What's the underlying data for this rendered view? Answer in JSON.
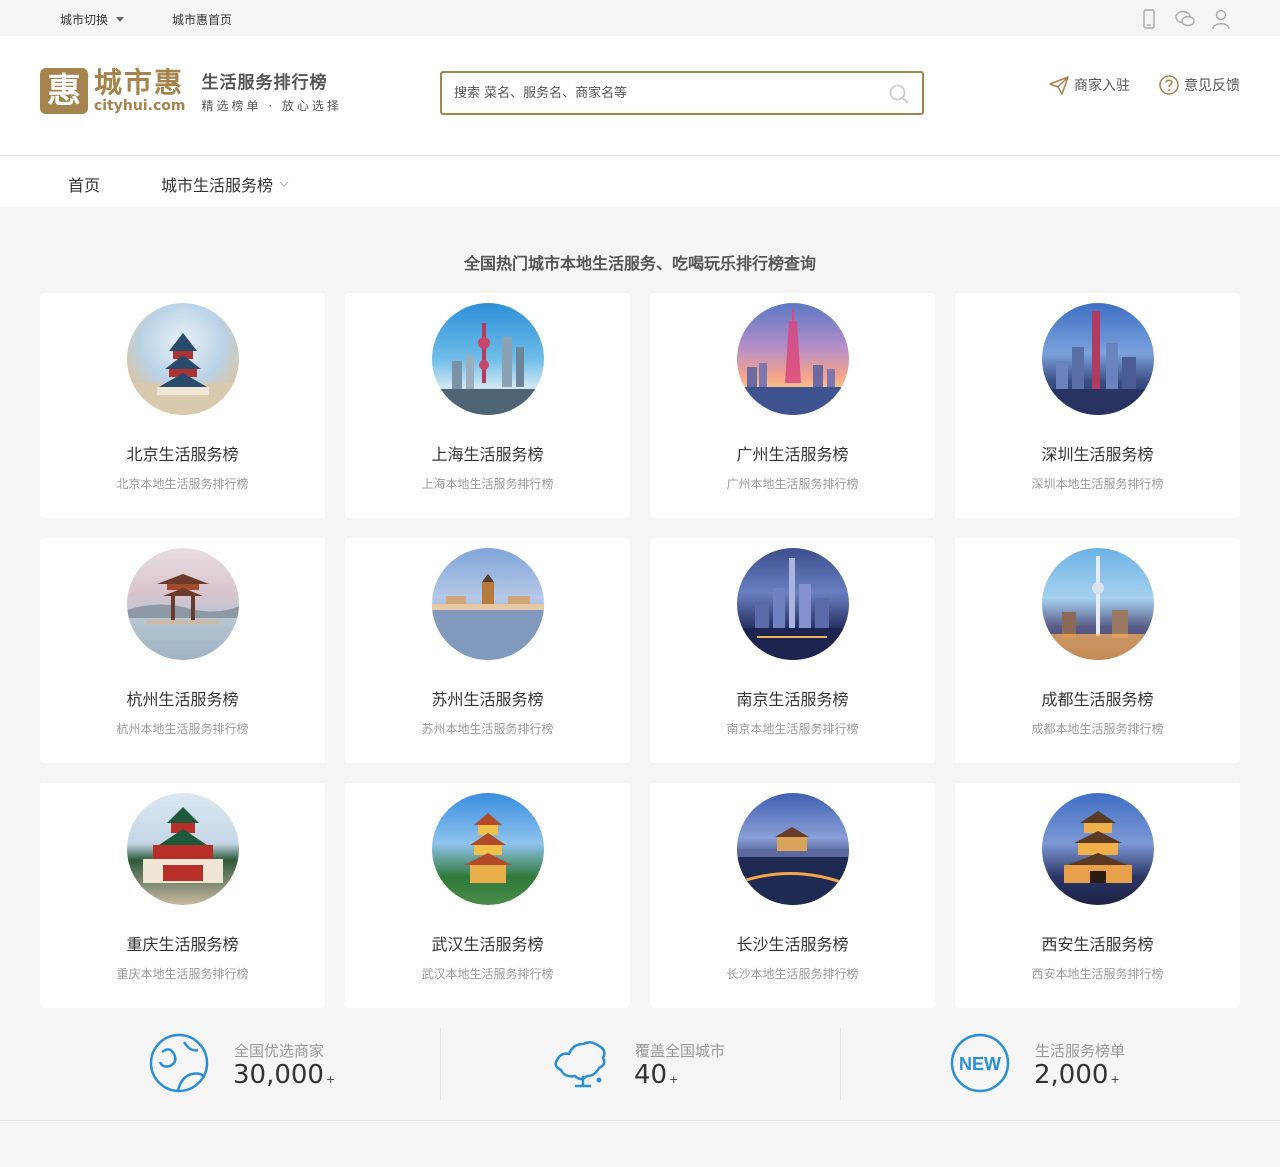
{
  "topbar": {
    "city_switch": "城市切换",
    "home_link": "城市惠首页",
    "icons": [
      "phone-icon",
      "wechat-icon",
      "user-icon"
    ]
  },
  "header": {
    "logo_mark": "惠",
    "logo_cn": "城市惠",
    "logo_en": "cityhui.com",
    "slogan_main": "生活服务排行榜",
    "slogan_sub": "精选榜单 · 放心选择",
    "search_placeholder": "搜索 菜名、服务名、商家名等",
    "actions": [
      {
        "label": "商家入驻",
        "icon": "paper-plane-icon"
      },
      {
        "label": "意见反馈",
        "icon": "question-icon"
      }
    ],
    "accent": "#a5834d"
  },
  "nav": {
    "items": [
      "首页",
      "城市生活服务榜"
    ]
  },
  "main": {
    "title": "全国热门城市本地生活服务、吃喝玩乐排行榜查询",
    "cities": [
      {
        "name": "北京生活服务榜",
        "sub": "北京本地生活服务排行榜"
      },
      {
        "name": "上海生活服务榜",
        "sub": "上海本地生活服务排行榜"
      },
      {
        "name": "广州生活服务榜",
        "sub": "广州本地生活服务排行榜"
      },
      {
        "name": "深圳生活服务榜",
        "sub": "深圳本地生活服务排行榜"
      },
      {
        "name": "杭州生活服务榜",
        "sub": "杭州本地生活服务排行榜"
      },
      {
        "name": "苏州生活服务榜",
        "sub": "苏州本地生活服务排行榜"
      },
      {
        "name": "南京生活服务榜",
        "sub": "南京本地生活服务排行榜"
      },
      {
        "name": "成都生活服务榜",
        "sub": "成都本地生活服务排行榜"
      },
      {
        "name": "重庆生活服务榜",
        "sub": "重庆本地生活服务排行榜"
      },
      {
        "name": "武汉生活服务榜",
        "sub": "武汉本地生活服务排行榜"
      },
      {
        "name": "长沙生活服务榜",
        "sub": "长沙本地生活服务排行榜"
      },
      {
        "name": "西安生活服务榜",
        "sub": "西安本地生活服务排行榜"
      }
    ]
  },
  "stats": [
    {
      "label": "全国优选商家",
      "value": "30,000",
      "plus": "+",
      "icon": "globe-icon"
    },
    {
      "label": "覆盖全国城市",
      "value": "40",
      "plus": "+",
      "icon": "china-map-icon"
    },
    {
      "label": "生活服务榜单",
      "value": "2,000",
      "plus": "+",
      "icon": "new-badge-icon",
      "badge": "NEW"
    }
  ],
  "colors": {
    "stat_icon": "#2b8fd6"
  }
}
